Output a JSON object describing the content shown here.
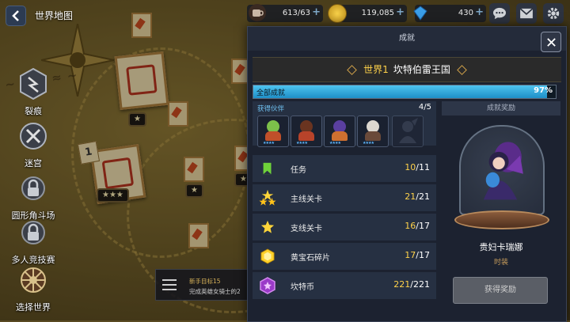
{
  "top_bar": {
    "page_title": "世界地图",
    "resources": [
      {
        "icon": "coffee-cup-icon",
        "value": "613/63"
      },
      {
        "icon": "gold-coin-icon",
        "value": "119,085"
      },
      {
        "icon": "gem-icon",
        "value": "430"
      }
    ],
    "buttons": [
      "chat-icon",
      "mail-icon",
      "settings-icon"
    ]
  },
  "left_nav": [
    {
      "label": "裂痕",
      "icon": "rift-icon"
    },
    {
      "label": "迷宫",
      "icon": "maze-icon"
    },
    {
      "label": "圆形角斗场",
      "icon": "arena-lock-icon"
    },
    {
      "label": "多人竞技赛",
      "icon": "multiplayer-lock-icon"
    },
    {
      "label": "选择世界",
      "icon": "world-wheel-icon"
    }
  ],
  "map": {
    "stage_number": "1",
    "stars_a": "★",
    "stars_b": "★",
    "stars_c": "★★★",
    "stars_d": "★"
  },
  "quest": {
    "title": "新手目标15",
    "desc": "完成英雄女骑士的2"
  },
  "dialog": {
    "header": "成就",
    "world_num": "世界1",
    "world_name": "坎特伯雷王国",
    "all_label": "全部成就",
    "all_percent": "97%",
    "all_progress": 0.97,
    "companions_label": "获得伙伴",
    "companions_count": "4/5",
    "companions": [
      {
        "head": "#7cc04a",
        "body": "#c0502a",
        "stars": "★★★★"
      },
      {
        "head": "#6a3420",
        "body": "#b8432a",
        "stars": "★★★★"
      },
      {
        "head": "#5a3fa0",
        "body": "#cf7030",
        "stars": "★★★★"
      },
      {
        "head": "#ddd8d0",
        "body": "#6a4a3a",
        "stars": "★★★★"
      }
    ],
    "rows": [
      {
        "label": "任务",
        "cur": "10",
        "total": "/11",
        "icon": "green-flag-icon"
      },
      {
        "label": "主线关卡",
        "cur": "21",
        "total": "/21",
        "icon": "triple-star-icon"
      },
      {
        "label": "支线关卡",
        "cur": "16",
        "total": "/17",
        "icon": "star-icon"
      },
      {
        "label": "黄宝石碎片",
        "cur": "17",
        "total": "/17",
        "icon": "yellow-gem-icon"
      },
      {
        "label": "坎特币",
        "cur": "221",
        "total": "/221",
        "icon": "purple-coin-icon"
      }
    ],
    "reward_title": "成就奖励",
    "reward_name": "贵妇卡瑞娜",
    "reward_type": "时装",
    "claim_label": "获得奖励"
  }
}
